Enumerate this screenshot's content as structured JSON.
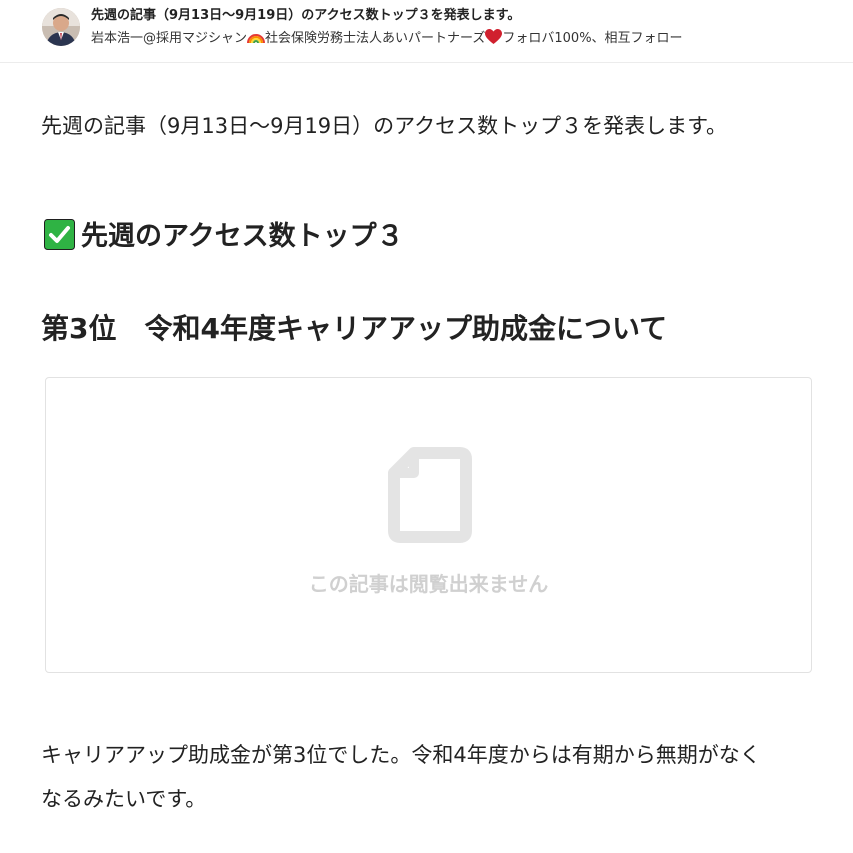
{
  "header": {
    "title": "先週の記事（9月13日〜9月19日）のアクセス数トップ３を発表します。",
    "author_prefix": "岩本浩一@採用マジシャン",
    "author_middle": "社会保険労務士法人あいパートナーズ",
    "author_suffix": "フォロバ100%、相互フォロー",
    "icons": [
      "rainbow-icon",
      "heart-icon"
    ]
  },
  "article": {
    "intro": "先週の記事（9月13日〜9月19日）のアクセス数トップ３を発表します。",
    "section_heading": "先週のアクセス数トップ３",
    "rank_heading": "第3位　令和4年度キャリアアップ助成金について",
    "embed": {
      "message": "この記事は閲覧出来ません",
      "icon": "document-icon"
    },
    "body_line1": "キャリアアップ助成金が第3位でした。令和4年度からは有期から無期がなく",
    "body_line2": "なるみたいです。"
  },
  "colors": {
    "check_green": "#2fb344",
    "heart_red": "#d0202e",
    "placeholder_gray": "#d0d0d0"
  }
}
